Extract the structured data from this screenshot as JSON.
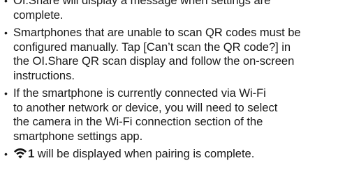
{
  "bullet_char": "•",
  "items": [
    {
      "lines": [
        "OI.Share will display a message when settings are"
      ],
      "hidden_top": true
    },
    {
      "lines": [
        "OI.Share will display a message when settings are",
        "complete."
      ]
    },
    {
      "lines": [
        "Smartphones that are unable to scan QR codes must be",
        "configured manually. Tap [Can’t scan the QR code?] in",
        "the OI.Share QR scan display and follow the on-screen",
        "instructions."
      ]
    },
    {
      "lines": [
        "If the smartphone is currently connected via Wi-Fi",
        "to another network or device, you will need to select",
        "the camera in the Wi-Fi connection section of the",
        "smartphone settings app."
      ]
    },
    {
      "icon": "wifi-icon",
      "badge_number": "1",
      "lines": [
        "will be displayed when pairing is complete."
      ]
    }
  ]
}
